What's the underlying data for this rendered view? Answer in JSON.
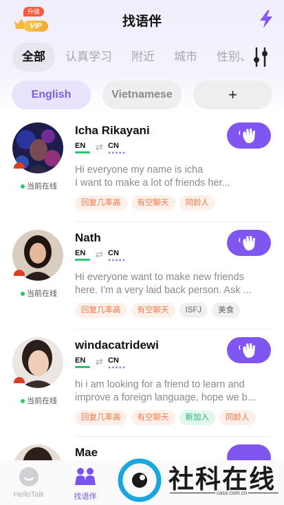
{
  "header": {
    "title": "找语伴",
    "vip_badge": "VIP",
    "upgrade_badge": "升级",
    "vip_icon": "crown-icon",
    "boost_icon": "lightning-icon"
  },
  "categories": [
    "全部",
    "认真学习",
    "附近",
    "城市",
    "性别、"
  ],
  "active_category": "全部",
  "language_filters": [
    {
      "label": "English",
      "active": true
    },
    {
      "label": "Vietnamese",
      "active": false
    },
    {
      "label": "+",
      "active": false
    }
  ],
  "partners": [
    {
      "name": "Icha Rikayani",
      "native": "EN",
      "learning": "CN",
      "status": "当前在线",
      "bio": "Hi everyone my name is icha\nI want to make a lot of friends her...",
      "tags": [
        {
          "label": "回复几率高",
          "style": "orange"
        },
        {
          "label": "有空聊天",
          "style": "orange"
        },
        {
          "label": "同龄人",
          "style": "orange"
        }
      ]
    },
    {
      "name": "Nath",
      "native": "EN",
      "learning": "CN",
      "status": "当前在线",
      "bio": "Hi everyone want to make new friends\nhere. I'm a very laid back person. Ask ...",
      "tags": [
        {
          "label": "回复几率高",
          "style": "orange"
        },
        {
          "label": "有空聊天",
          "style": "orange"
        },
        {
          "label": "ISFJ",
          "style": "grey"
        },
        {
          "label": "美食",
          "style": "grey"
        }
      ]
    },
    {
      "name": "windacatridewi",
      "native": "EN",
      "learning": "CN",
      "status": "当前在线",
      "bio": "hi i am looking for a friend to learn and\nimprove a foreign language, hope we b...",
      "tags": [
        {
          "label": "回复几率高",
          "style": "orange"
        },
        {
          "label": "有空聊天",
          "style": "orange"
        },
        {
          "label": "新加入",
          "style": "green"
        },
        {
          "label": "同龄人",
          "style": "orange"
        }
      ]
    },
    {
      "name": "Mae",
      "native": "",
      "learning": "",
      "status": "",
      "bio": "",
      "tags": []
    }
  ],
  "tabbar": {
    "tabs": [
      {
        "label": "HelloTalk",
        "icon": "chat-bubble-icon",
        "active": false
      },
      {
        "label": "找语伴",
        "icon": "people-icon",
        "active": true
      }
    ]
  },
  "watermark": {
    "text": "社科在线",
    "url": "cass.com.cn"
  },
  "colors": {
    "accent": "#8056f0",
    "online": "#2ac46a",
    "tag_orange": "#f07a45",
    "tag_green": "#25b574"
  }
}
